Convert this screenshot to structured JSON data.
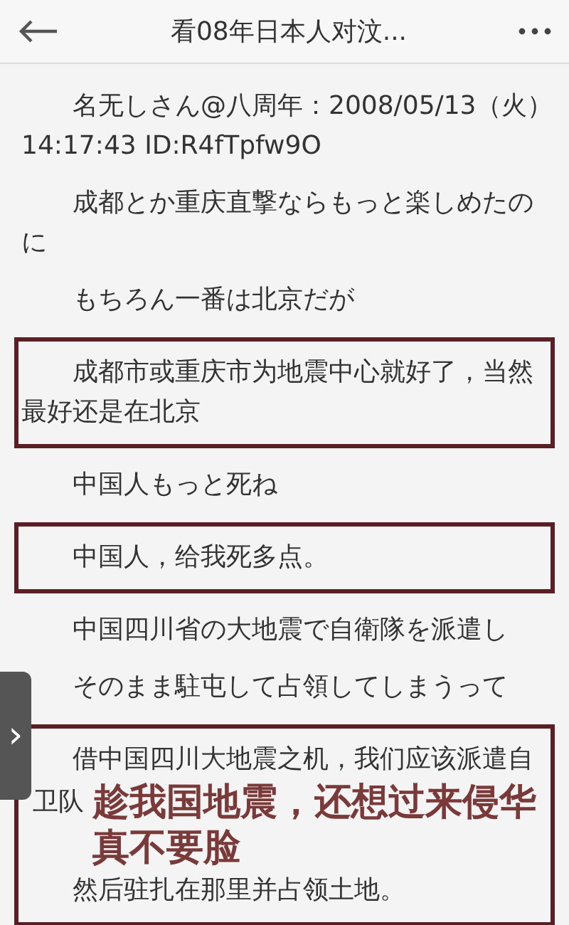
{
  "header": {
    "title": "看08年日本人对汶..."
  },
  "side_tab": {
    "label": "›"
  },
  "posts": [
    {
      "kind": "meta",
      "text": "名无しさん@八周年：2008/05/13（火）\n14:17:43 ID:R4fTpfw9O"
    },
    {
      "kind": "plain",
      "text": "成都とか重庆直撃ならもっと楽しめたのに"
    },
    {
      "kind": "plain",
      "text": "もちろん一番は北京だが"
    },
    {
      "kind": "boxed",
      "text": "成都市或重庆市为地震中心就好了，当然最好还是在北京"
    },
    {
      "kind": "plain",
      "text": "中国人もっと死ね"
    },
    {
      "kind": "boxed",
      "text": "中国人，给我死多点。"
    },
    {
      "kind": "plain",
      "text": "中国四川省の大地震で自衛隊を派遣し"
    },
    {
      "kind": "plain",
      "text": "そのまま駐屯して占領してしまうって"
    },
    {
      "kind": "boxed",
      "text": "借中国四川大地震之机，我们应该派遣自",
      "lead": "卫队",
      "caption": "趁我国地震，还想过来侵华真不要脸",
      "tail": "然后驻扎在那里并占领土地。"
    }
  ]
}
